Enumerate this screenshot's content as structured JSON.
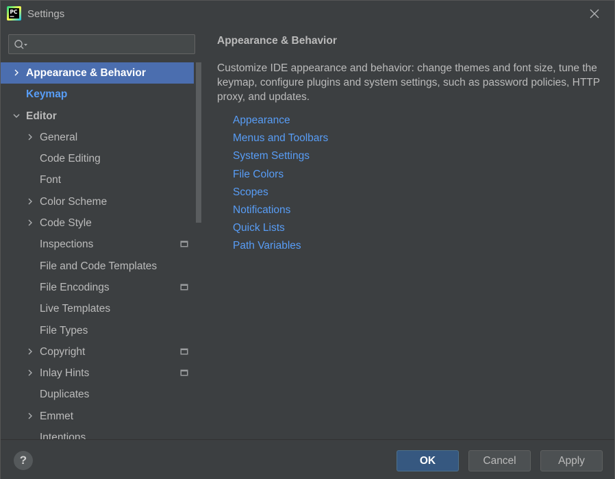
{
  "window": {
    "title": "Settings",
    "app_icon_text": "PC"
  },
  "search": {
    "placeholder": "",
    "value": ""
  },
  "sidebar": {
    "items": [
      {
        "label": "Appearance & Behavior",
        "indent": 0,
        "chevron": "right",
        "selected": true,
        "style": "bold",
        "project_icon": false
      },
      {
        "label": "Keymap",
        "indent": 0,
        "chevron": "none",
        "selected": false,
        "style": "link",
        "project_icon": false
      },
      {
        "label": "Editor",
        "indent": 0,
        "chevron": "down",
        "selected": false,
        "style": "bold",
        "project_icon": false
      },
      {
        "label": "General",
        "indent": 1,
        "chevron": "right",
        "selected": false,
        "style": "normal",
        "project_icon": false
      },
      {
        "label": "Code Editing",
        "indent": 1,
        "chevron": "none",
        "selected": false,
        "style": "normal",
        "project_icon": false
      },
      {
        "label": "Font",
        "indent": 1,
        "chevron": "none",
        "selected": false,
        "style": "normal",
        "project_icon": false
      },
      {
        "label": "Color Scheme",
        "indent": 1,
        "chevron": "right",
        "selected": false,
        "style": "normal",
        "project_icon": false
      },
      {
        "label": "Code Style",
        "indent": 1,
        "chevron": "right",
        "selected": false,
        "style": "normal",
        "project_icon": false
      },
      {
        "label": "Inspections",
        "indent": 1,
        "chevron": "none",
        "selected": false,
        "style": "normal",
        "project_icon": true
      },
      {
        "label": "File and Code Templates",
        "indent": 1,
        "chevron": "none",
        "selected": false,
        "style": "normal",
        "project_icon": false
      },
      {
        "label": "File Encodings",
        "indent": 1,
        "chevron": "none",
        "selected": false,
        "style": "normal",
        "project_icon": true
      },
      {
        "label": "Live Templates",
        "indent": 1,
        "chevron": "none",
        "selected": false,
        "style": "normal",
        "project_icon": false
      },
      {
        "label": "File Types",
        "indent": 1,
        "chevron": "none",
        "selected": false,
        "style": "normal",
        "project_icon": false
      },
      {
        "label": "Copyright",
        "indent": 1,
        "chevron": "right",
        "selected": false,
        "style": "normal",
        "project_icon": true
      },
      {
        "label": "Inlay Hints",
        "indent": 1,
        "chevron": "right",
        "selected": false,
        "style": "normal",
        "project_icon": true
      },
      {
        "label": "Duplicates",
        "indent": 1,
        "chevron": "none",
        "selected": false,
        "style": "normal",
        "project_icon": false
      },
      {
        "label": "Emmet",
        "indent": 1,
        "chevron": "right",
        "selected": false,
        "style": "normal",
        "project_icon": false
      },
      {
        "label": "Intentions",
        "indent": 1,
        "chevron": "none",
        "selected": false,
        "style": "normal",
        "project_icon": false
      }
    ]
  },
  "main": {
    "title": "Appearance & Behavior",
    "description": "Customize IDE appearance and behavior: change themes and font size, tune the keymap, configure plugins and system settings, such as password policies, HTTP proxy, and updates.",
    "links": [
      "Appearance",
      "Menus and Toolbars",
      "System Settings",
      "File Colors",
      "Scopes",
      "Notifications",
      "Quick Lists",
      "Path Variables"
    ]
  },
  "footer": {
    "help_label": "?",
    "ok_label": "OK",
    "cancel_label": "Cancel",
    "apply_label": "Apply"
  },
  "colors": {
    "background": "#3c3f41",
    "selection": "#4b6eaf",
    "link": "#589df6",
    "text": "#bbbbbb",
    "ok_button": "#365880"
  }
}
